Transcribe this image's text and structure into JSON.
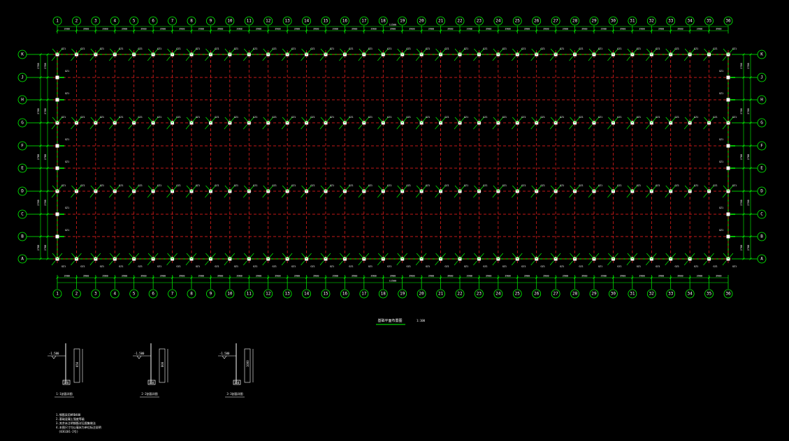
{
  "drawing": {
    "background_color": "#000000",
    "grid_line_color": "#ff2020",
    "annotation_color": "#00ff00",
    "text_color": "#ffffff",
    "column_axes": [
      "1",
      "2",
      "3",
      "4",
      "5",
      "6",
      "7",
      "8",
      "9",
      "10",
      "11",
      "12",
      "13",
      "14",
      "15",
      "16",
      "17",
      "18",
      "19",
      "20",
      "21",
      "22",
      "23",
      "24",
      "25",
      "26",
      "27",
      "28",
      "29",
      "30",
      "31",
      "32",
      "33",
      "34",
      "35",
      "36"
    ],
    "row_axes": [
      "K",
      "J",
      "H",
      "G",
      "F",
      "E",
      "D",
      "C",
      "B",
      "A"
    ],
    "overall_dimension": "11500",
    "bay_dimension": "3900",
    "row_spacing_label": "2700",
    "column_tag": "GZ1",
    "plan_title": "基础平面布置图",
    "plan_scale": "1:100",
    "details": [
      {
        "label": "1-1剖面详图",
        "elev": "-1.500",
        "dim": "650",
        "base": "120"
      },
      {
        "label": "2-2剖面详图",
        "elev": "-1.500",
        "dim": "800",
        "base": "150"
      },
      {
        "label": "3-3剖面详图",
        "elev": "-1.500",
        "dim": "1000",
        "base": "150"
      }
    ],
    "notes": [
      "1.钢筋采用HRB400",
      "2.基础混凝土强度等级",
      "3.其余未注明钢筋详见图集做法",
      "4.本图尺寸均以毫米为单位标注说明",
      "(03G101-2号)"
    ]
  }
}
